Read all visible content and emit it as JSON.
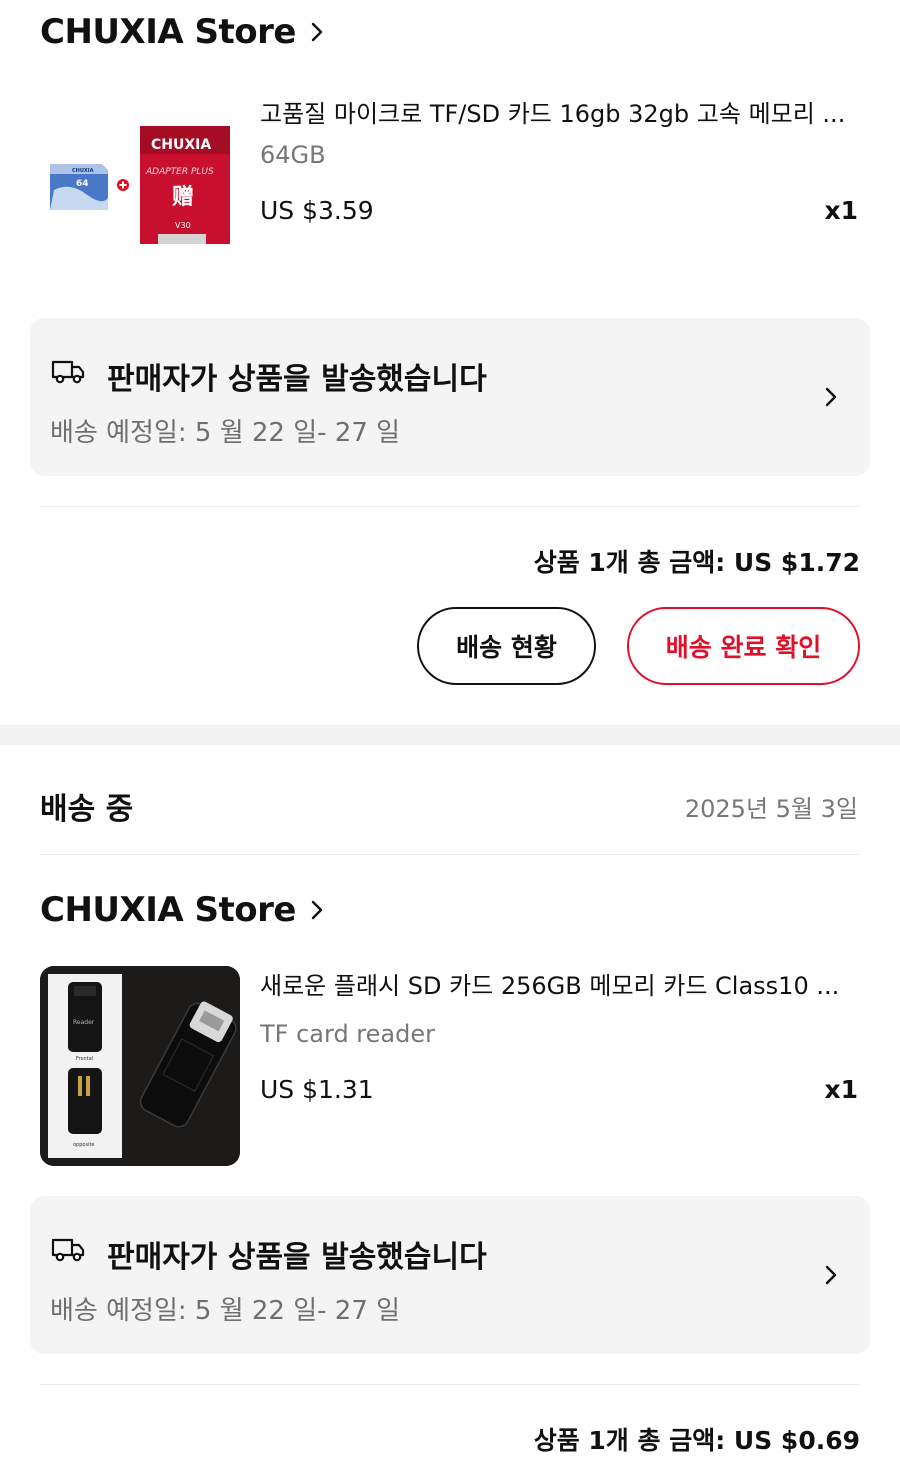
{
  "orders": [
    {
      "store_name": "CHUXIA Store",
      "product": {
        "title": "고품질 마이크로 TF/SD 카드 16gb 32gb 고속 메모리 ...",
        "variant": "64GB",
        "price": "US $3.59",
        "quantity": "x1",
        "image": {
          "card_brand": "CHUXIA",
          "card_capacity": "64",
          "adapter_brand": "CHUXIA",
          "adapter_text": "ADAPTER PLUS",
          "gift_char": "赠",
          "adapter_marks": "V30"
        }
      },
      "shipping": {
        "title": "판매자가 상품을 발송했습니다",
        "eta": "배송 예정일: 5 월 22 일- 27 일"
      },
      "total": "상품 1개 총 금액: US $1.72",
      "buttons": {
        "track": "배송 현황",
        "confirm": "배송 완료 확인"
      }
    },
    {
      "status": "배송 중",
      "date": "2025년 5월 3일",
      "store_name": "CHUXIA Store",
      "product": {
        "title": "새로운 플래시 SD 카드 256GB 메모리 카드 Class10 ...",
        "variant": "TF card reader",
        "price": "US $1.31",
        "quantity": "x1",
        "image": {
          "front_caption": "Frontal",
          "back_caption": "opposite",
          "reader_text": "Reader"
        }
      },
      "shipping": {
        "title": "판매자가 상품을 발송했습니다",
        "eta": "배송 예정일: 5 월 22 일- 27 일"
      },
      "total": "상품 1개 총 금액: US $0.69"
    }
  ],
  "colors": {
    "accent_red": "#e0102a",
    "text_primary": "#111111",
    "text_secondary": "#777777",
    "shipping_box_bg": "#f4f4f4"
  },
  "icons": [
    "chevron-right-icon",
    "delivery-truck-icon"
  ]
}
